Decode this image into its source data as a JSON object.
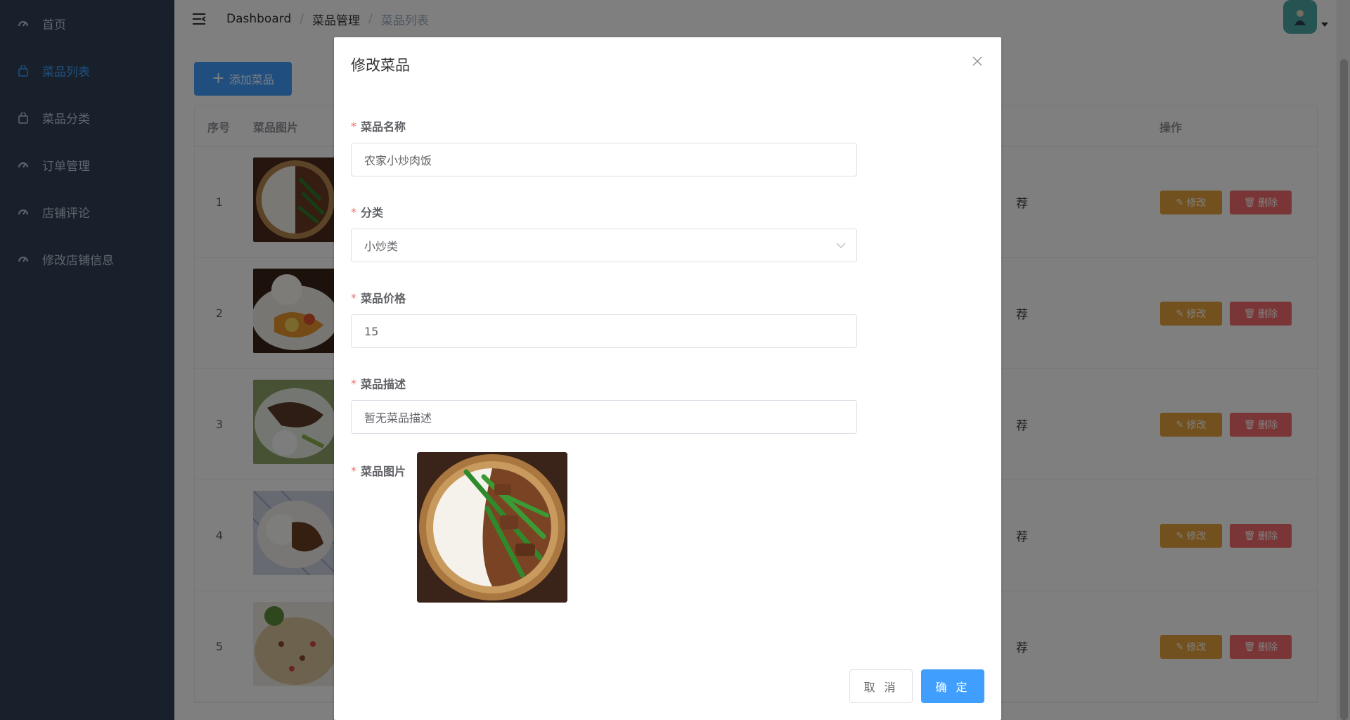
{
  "sidebar": {
    "items": [
      {
        "label": "首页",
        "icon": "dashboard-icon"
      },
      {
        "label": "菜品列表",
        "icon": "bag-icon",
        "active": true
      },
      {
        "label": "菜品分类",
        "icon": "bag-icon"
      },
      {
        "label": "订单管理",
        "icon": "dashboard-icon"
      },
      {
        "label": "店铺评论",
        "icon": "dashboard-icon"
      },
      {
        "label": "修改店铺信息",
        "icon": "dashboard-icon"
      }
    ]
  },
  "header": {
    "breadcrumb": [
      "Dashboard",
      "菜品管理",
      "菜品列表"
    ]
  },
  "main": {
    "add_button": "添加菜品",
    "table": {
      "columns": {
        "no": "序号",
        "image": "菜品图片",
        "operation": "操作"
      },
      "rows": [
        {
          "no": "1",
          "tag": "荐",
          "edit": "修改",
          "delete": "删除"
        },
        {
          "no": "2",
          "tag": "荐",
          "edit": "修改",
          "delete": "删除"
        },
        {
          "no": "3",
          "tag": "荐",
          "edit": "修改",
          "delete": "删除"
        },
        {
          "no": "4",
          "tag": "荐",
          "edit": "修改",
          "delete": "删除"
        },
        {
          "no": "5",
          "tag": "荐",
          "edit": "修改",
          "delete": "删除"
        }
      ]
    }
  },
  "dialog": {
    "title": "修改菜品",
    "fields": {
      "name": {
        "label": "菜品名称",
        "value": "农家小炒肉饭"
      },
      "category": {
        "label": "分类",
        "value": "小炒类"
      },
      "price": {
        "label": "菜品价格",
        "value": "15"
      },
      "description": {
        "label": "菜品描述",
        "value": "暂无菜品描述"
      },
      "image": {
        "label": "菜品图片"
      }
    },
    "cancel": "取 消",
    "confirm": "确 定"
  },
  "colors": {
    "primary": "#409eff",
    "warning": "#e6a23c",
    "danger": "#f56c6c",
    "sidebar": "#304156"
  }
}
